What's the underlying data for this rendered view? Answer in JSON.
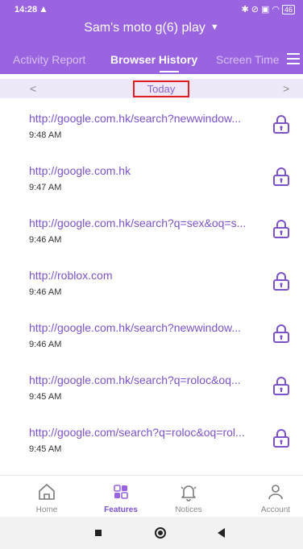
{
  "status_bar": {
    "time": "14:28",
    "alert_icon": "warning-icon",
    "battery": "46"
  },
  "header": {
    "device_name": "Sam's moto g(6) play",
    "tabs": [
      {
        "label": "Activity Report",
        "active": false
      },
      {
        "label": "Browser History",
        "active": true
      },
      {
        "label": "Screen Time",
        "active": false
      }
    ],
    "menu_icon": "hamburger-menu-icon"
  },
  "date_nav": {
    "prev": "<",
    "label": "Today",
    "next": ">"
  },
  "history": [
    {
      "url": "http://google.com.hk/search?newwindow...",
      "time": "9:48 AM"
    },
    {
      "url": "http://google.com.hk",
      "time": "9:47 AM"
    },
    {
      "url": "http://google.com.hk/search?q=sex&oq=s...",
      "time": "9:46 AM"
    },
    {
      "url": "http://roblox.com",
      "time": "9:46 AM"
    },
    {
      "url": "http://google.com.hk/search?newwindow...",
      "time": "9:46 AM"
    },
    {
      "url": "http://google.com.hk/search?q=roloc&oq...",
      "time": "9:45 AM"
    },
    {
      "url": "http://google.com/search?q=roloc&oq=rol...",
      "time": "9:45 AM"
    }
  ],
  "bottom_nav": {
    "items": [
      {
        "label": "Home",
        "icon": "home-icon",
        "active": false
      },
      {
        "label": "Features",
        "icon": "grid-icon",
        "active": true
      },
      {
        "label": "Notices",
        "icon": "bell-icon",
        "active": false
      },
      {
        "label": "Account",
        "icon": "user-icon",
        "active": false
      }
    ]
  },
  "colors": {
    "header": "#9a63e0",
    "accent": "#7b52c8",
    "date_bar": "#efe8f9",
    "highlight_border": "#e02020"
  }
}
